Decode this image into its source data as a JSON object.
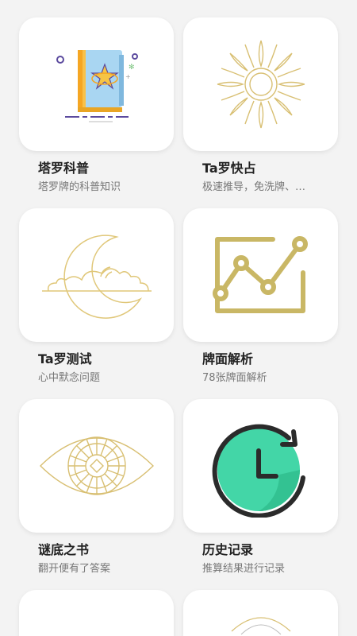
{
  "items": [
    {
      "title": "塔罗科普",
      "subtitle": "塔罗牌的科普知识",
      "icon": "star-book-icon"
    },
    {
      "title": "Ta罗快占",
      "subtitle": "极速推导，免洗牌、…",
      "icon": "sun-icon"
    },
    {
      "title": "Ta罗测试",
      "subtitle": "心中默念问题",
      "icon": "moon-cloud-icon"
    },
    {
      "title": "牌面解析",
      "subtitle": "78张牌面解析",
      "icon": "trend-chart-icon"
    },
    {
      "title": "谜底之书",
      "subtitle": "翻开便有了答案",
      "icon": "eye-icon"
    },
    {
      "title": "历史记录",
      "subtitle": "推算结果进行记录",
      "icon": "history-clock-icon"
    }
  ],
  "colors": {
    "gold": "#d8bf72",
    "olive_gold": "#c9b765",
    "mint": "#43d6a7",
    "book_blue": "#a9d6f2",
    "book_orange": "#f5a623",
    "star_yellow": "#f6c445",
    "dark": "#2b2b2b"
  }
}
